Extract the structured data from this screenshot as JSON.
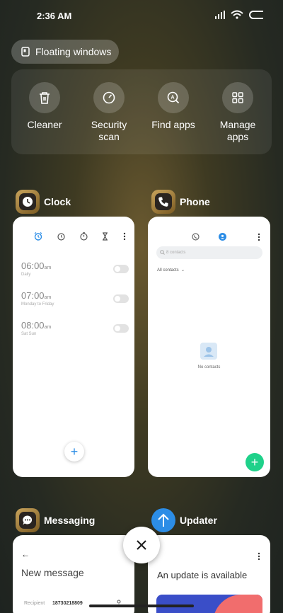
{
  "status": {
    "time": "2:36 AM"
  },
  "floating_windows": {
    "label": "Floating windows"
  },
  "quick_actions": [
    {
      "label": "Cleaner",
      "icon": "trash-icon"
    },
    {
      "label": "Security\nscan",
      "icon": "gauge-icon"
    },
    {
      "label": "Find apps",
      "icon": "search-app-icon"
    },
    {
      "label": "Manage\napps",
      "icon": "grid-icon"
    }
  ],
  "recent_apps": {
    "clock": {
      "name": "Clock",
      "alarms": [
        {
          "time": "06:00",
          "ampm": "am",
          "repeat": "Daily"
        },
        {
          "time": "07:00",
          "ampm": "am",
          "repeat": "Monday to Friday"
        },
        {
          "time": "08:00",
          "ampm": "am",
          "repeat": "Sat Sun"
        }
      ]
    },
    "phone": {
      "name": "Phone",
      "search_placeholder": "8 contacts",
      "filter": "All contacts",
      "empty_text": "No contacts"
    },
    "messaging": {
      "name": "Messaging",
      "title": "New message",
      "recipient_label": "Recipient",
      "recipient_value": "18730218809"
    },
    "updater": {
      "name": "Updater",
      "message": "An update is available"
    }
  },
  "colors": {
    "accent": "#2c8de6",
    "green": "#1fd18a"
  }
}
